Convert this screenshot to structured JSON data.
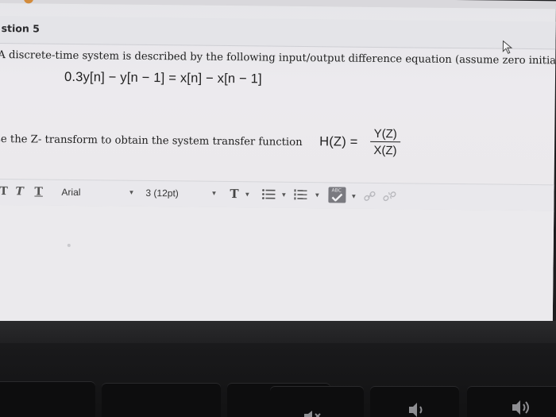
{
  "question": {
    "title": "stion 5",
    "prompt_line": "A discrete-time system is described by the following input/output difference equation (assume zero initials",
    "equation": "0.3y[n] − y[n − 1] = x[n] − x[n − 1]",
    "instruction": "se the Z- transform to obtain the system transfer function",
    "transfer_lhs": "H(Z) =",
    "transfer_num": "Y(Z)",
    "transfer_den": "X(Z)"
  },
  "toolbar": {
    "style_buttons": [
      "T",
      "T",
      "T"
    ],
    "font_family": "Arial",
    "font_size": "3 (12pt)",
    "text_color_label": "T",
    "spell_label": "ABC"
  },
  "icons": {
    "cursor": "mouse-pointer-icon",
    "link": "link-icon",
    "unlink": "unlink-icon",
    "bullets": "bulleted-list-icon",
    "numbered": "numbered-list-icon",
    "spellcheck": "spellcheck-icon"
  },
  "keyboard": {
    "keys": [
      "mute-key",
      "volume-down-key",
      "volume-up-key"
    ]
  }
}
